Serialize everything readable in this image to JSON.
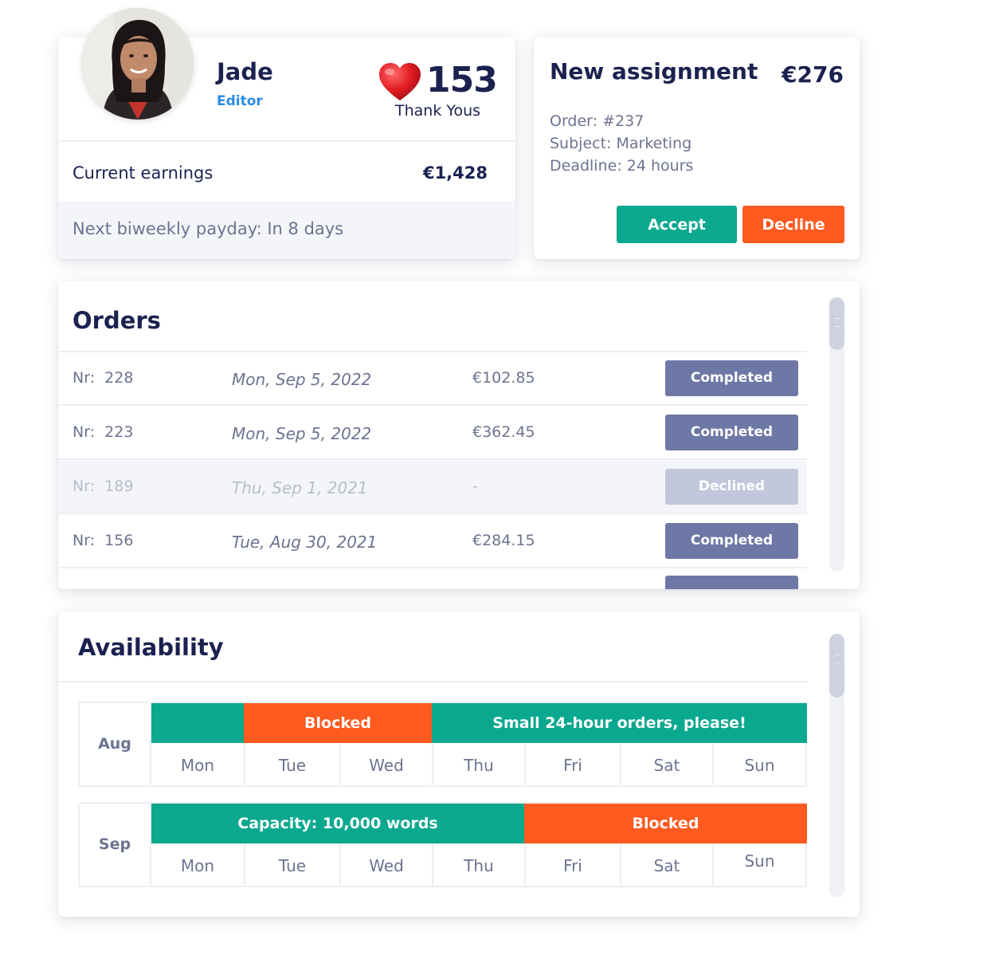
{
  "profile": {
    "name": "Jade",
    "role": "Editor",
    "thanks_count": "153",
    "thanks_label": "Thank Yous",
    "earnings_label": "Current earnings",
    "earnings_value": "€1,428",
    "payday_text": "Next biweekly payday: In 8 days"
  },
  "assignment": {
    "title": "New assignment",
    "price": "€276",
    "order": "Order: #237",
    "subject": "Subject: Marketing",
    "deadline": "Deadline: 24 hours",
    "accept_label": "Accept",
    "decline_label": "Decline"
  },
  "orders": {
    "title": "Orders",
    "rows": [
      {
        "nr": "Nr:  228",
        "date": "Mon, Sep 5, 2022",
        "amount": "€102.85",
        "status": "Completed"
      },
      {
        "nr": "Nr:  223",
        "date": "Mon, Sep 5, 2022",
        "amount": "€362.45",
        "status": "Completed"
      },
      {
        "nr": "Nr:  189",
        "date": "Thu, Sep 1, 2021",
        "amount": "-",
        "status": "Declined"
      },
      {
        "nr": "Nr:  156",
        "date": "Tue, Aug 30, 2021",
        "amount": "€284.15",
        "status": "Completed"
      }
    ]
  },
  "availability": {
    "title": "Availability",
    "months": [
      {
        "month": "Aug",
        "days": [
          "Mon",
          "Tue",
          "Wed",
          "Thu",
          "Fri",
          "Sat",
          "Sun"
        ],
        "bars": [
          {
            "label": "",
            "color": "teal"
          },
          {
            "label": "Blocked",
            "color": "orange"
          },
          {
            "label": "Small 24-hour orders, please!",
            "color": "teal"
          }
        ]
      },
      {
        "month": "Sep",
        "days": [
          "Mon",
          "Tue",
          "Wed",
          "Thu",
          "Fri",
          "Sat",
          "Sun"
        ],
        "bars": [
          {
            "label": "Capacity: 10,000 words",
            "color": "teal"
          },
          {
            "label": "Blocked",
            "color": "orange"
          }
        ]
      }
    ]
  },
  "colors": {
    "navy": "#1b2250",
    "accent_blue": "#2a8be3",
    "teal": "#0aa88f",
    "orange": "#ff5a1f",
    "status_completed": "#6e78a6",
    "status_declined": "#c2c7dc",
    "heart": "#e31b23"
  },
  "icons": {
    "heart": "heart-icon",
    "scrollbar": "scrollbar-grip-icon"
  }
}
